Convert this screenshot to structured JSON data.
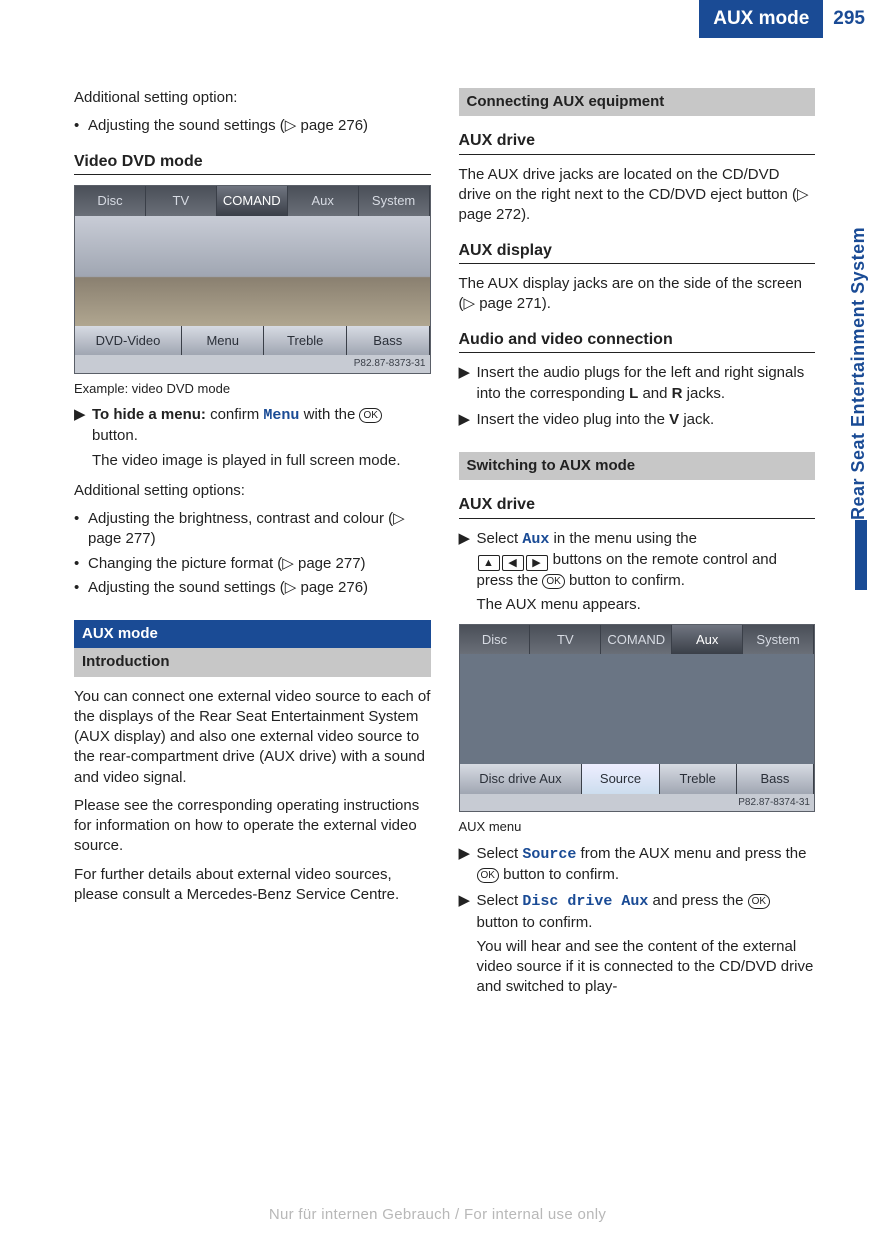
{
  "header": {
    "title": "AUX mode",
    "page": "295"
  },
  "sideTab": "Rear Seat Entertainment System",
  "left": {
    "addOpt": "Additional setting option:",
    "b1": "Adjusting the sound settings (▷ page 276)",
    "h_video": "Video DVD mode",
    "shot1": {
      "tabs": [
        "Disc",
        "TV",
        "COMAND",
        "Aux",
        "System"
      ],
      "bot": [
        "DVD-Video",
        "Menu",
        "Treble",
        "Bass"
      ],
      "ref": "P82.87-8373-31"
    },
    "cap1": "Example: video DVD mode",
    "s1a": "To hide a menu:",
    "s1b": " confirm ",
    "s1c": "Menu",
    "s1d": " with the ",
    "s1e": " button.",
    "s1f": "The video image is played in full screen mode.",
    "addOpts2": "Additional setting options:",
    "b2": "Adjusting the brightness, contrast and colour (▷ page 277)",
    "b3": "Changing the picture format (▷ page 277)",
    "b4": "Adjusting the sound settings (▷ page 276)",
    "h2_aux": "AUX mode",
    "h2_intro": "Introduction",
    "p_intro1": "You can connect one external video source to each of the displays of the Rear Seat Entertainment System (AUX display) and also one external video source to the rear-compartment drive (AUX drive) with a sound and video signal.",
    "p_intro2": "Please see the corresponding operating instructions for information on how to operate the external video source.",
    "p_intro3": "For further details about external video sources, please consult a Mercedes-Benz Service Centre."
  },
  "right": {
    "h2_conn": "Connecting AUX equipment",
    "h_drive": "AUX drive",
    "p_drive": "The AUX drive jacks are located on the CD/DVD drive on the right next to the CD/DVD eject button (▷ page 272).",
    "h_disp": "AUX display",
    "p_disp": "The AUX display jacks are on the side of the screen (▷ page 271).",
    "h_av": "Audio and video connection",
    "s_av1a": "Insert the audio plugs for the left and right signals into the corresponding ",
    "s_av1b": " and ",
    "s_av1c": " jacks.",
    "s_av2a": "Insert the video plug into the ",
    "s_av2b": " jack.",
    "bold_L": "L",
    "bold_R": "R",
    "bold_V": "V",
    "h2_switch": "Switching to AUX mode",
    "h_drive2": "AUX drive",
    "s_sw1a": "Select ",
    "s_sw1_aux": "Aux",
    "s_sw1b": " in the menu using the ",
    "s_sw1c": " buttons on the remote control and press the ",
    "s_sw1d": " button to confirm.",
    "s_sw1e": "The AUX menu appears.",
    "shot2": {
      "tabs": [
        "Disc",
        "TV",
        "COMAND",
        "Aux",
        "System"
      ],
      "bot": [
        "Disc drive Aux",
        "Source",
        "Treble",
        "Bass"
      ],
      "ref": "P82.87-8374-31"
    },
    "cap2": "AUX menu",
    "s_src1a": "Select ",
    "s_src1_src": "Source",
    "s_src1b": " from the AUX menu and press the ",
    "s_src1c": " button to confirm.",
    "s_dd1a": "Select ",
    "s_dd1_dd": "Disc drive Aux",
    "s_dd1b": " and press the ",
    "s_dd1c": " button to confirm.",
    "s_dd2": "You will hear and see the content of the external video source if it is connected to the CD/DVD drive and switched to play-"
  },
  "watermark": "Nur für internen Gebrauch / For internal use only"
}
